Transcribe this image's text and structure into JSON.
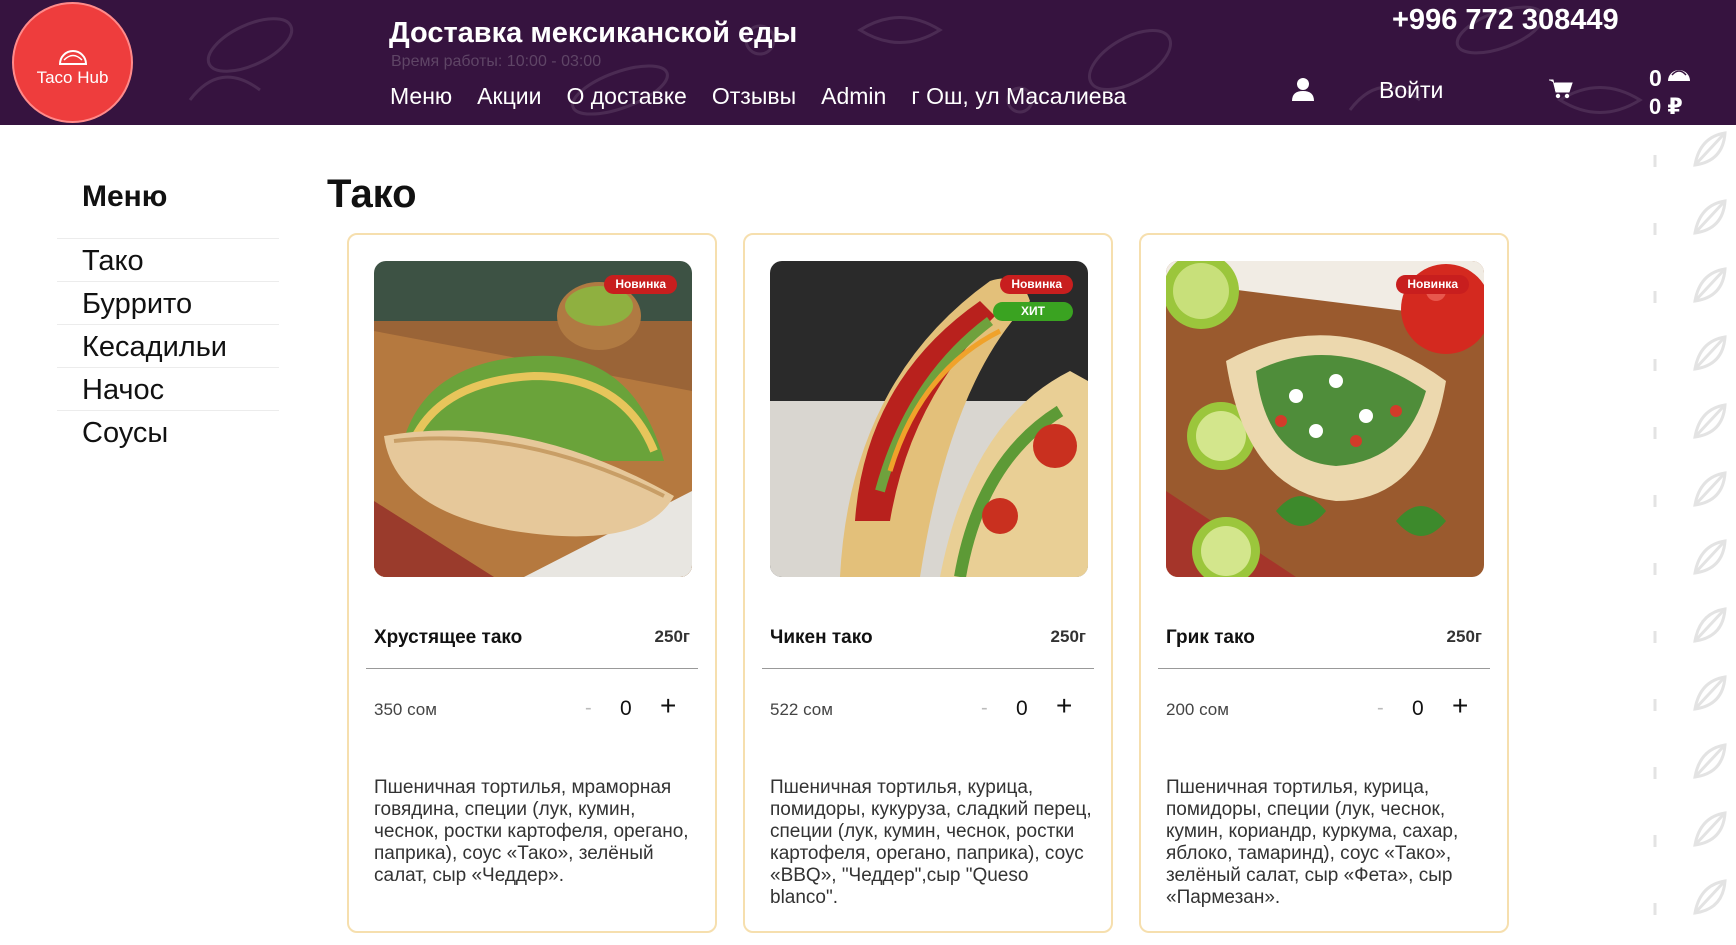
{
  "header": {
    "logo_text": "Taco Hub",
    "title": "Доставка мексиканской еды",
    "hours": "Время работы: 10:00 - 03:00",
    "phone": "+996 772 308449",
    "nav": [
      "Меню",
      "Акции",
      "О доставке",
      "Отзывы",
      "Admin",
      "г Ош, ул Масалиева"
    ],
    "login_label": "Войти",
    "cart_count": "0",
    "cart_total": "0 ₽",
    "bg_color": "#36133f",
    "logo_color": "#ee3d3d"
  },
  "sidebar": {
    "title": "Меню",
    "items": [
      "Тако",
      "Буррито",
      "Кесадильи",
      "Начос",
      "Соусы"
    ]
  },
  "main": {
    "section_title": "Тако",
    "products": [
      {
        "name": "Хрустящее тако",
        "weight": "250г",
        "price": "350 сом",
        "quantity": "0",
        "minus": "-",
        "plus": "+",
        "badges": [
          "Новинка"
        ],
        "description": "Пшеничная тортилья, мраморная говядина, специи (лук, кумин, чеснок, ростки картофеля, орегано, паприка), соус «Тако», зелёный салат, сыр «Чеддер»."
      },
      {
        "name": "Чикен тако",
        "weight": "250г",
        "price": "522 сом",
        "quantity": "0",
        "minus": "-",
        "plus": "+",
        "badges": [
          "Новинка",
          "ХИТ"
        ],
        "description": "Пшеничная тортилья, курица, помидоры, кукуруза, сладкий перец, специи (лук, кумин, чеснок, ростки картофеля, орегано, паприка), соус «BBQ», \"Чеддер\",сыр \"Queso blanco\"."
      },
      {
        "name": "Грик тако",
        "weight": "250г",
        "price": "200 сом",
        "quantity": "0",
        "minus": "-",
        "plus": "+",
        "badges": [
          "Новинка"
        ],
        "description": "Пшеничная тортилья, курица, помидоры, специи (лук, чеснок, кумин, кориандр, куркума, сахар, яблоко, тамаринд), соус «Тако», зелёный салат, сыр «Фета», сыр «Пармезан»."
      }
    ]
  },
  "colors": {
    "badge_new": "#c81e1e",
    "badge_hit": "#3aa321",
    "card_border": "#f6dfae"
  }
}
